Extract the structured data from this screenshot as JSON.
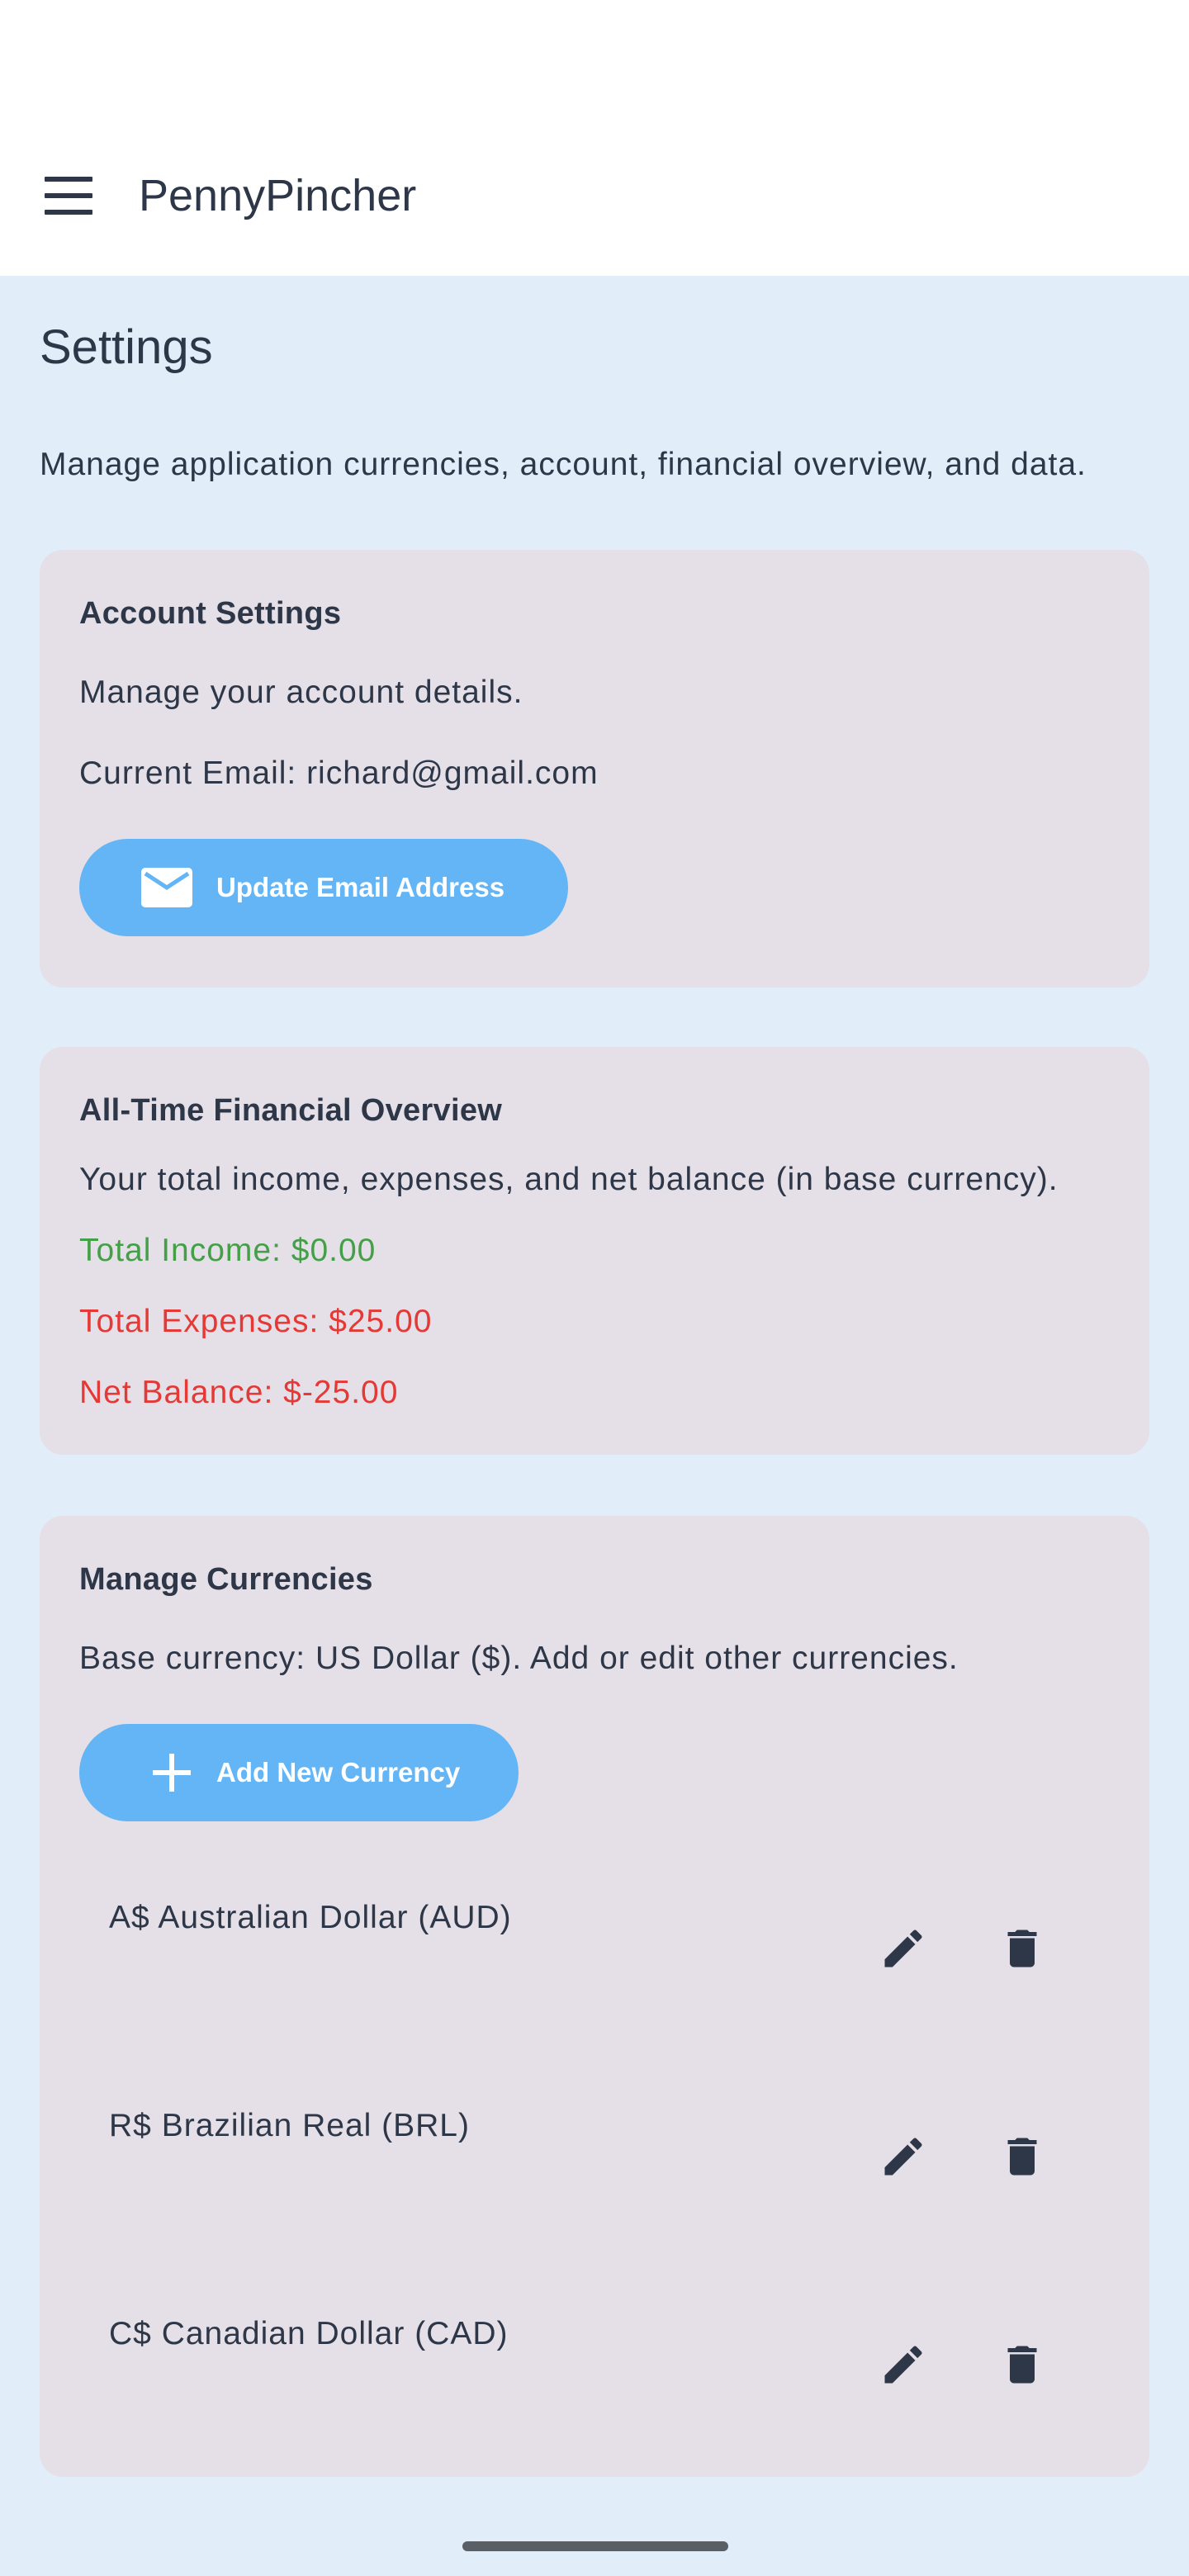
{
  "app": {
    "title": "PennyPincher",
    "menu_icon": "menu-icon"
  },
  "page": {
    "title": "Settings",
    "description": "Manage application currencies, account, financial overview, and data."
  },
  "account": {
    "title": "Account Settings",
    "subtitle": "Manage your account details.",
    "current_email": "Current Email: richard@gmail.com",
    "update_button": "Update Email Address",
    "update_icon": "mail-icon"
  },
  "overview": {
    "title": "All-Time Financial Overview",
    "subtitle": "Your total income, expenses, and net balance (in base currency).",
    "total_income": "Total Income: $0.00",
    "total_expenses": "Total Expenses: $25.00",
    "net_balance": "Net Balance: $-25.00",
    "colors": {
      "income": "#43a047",
      "expense": "#e53935"
    }
  },
  "currencies": {
    "title": "Manage Currencies",
    "subtitle": "Base currency: US Dollar ($). Add or edit other currencies.",
    "add_button": "Add New Currency",
    "add_icon": "plus-icon",
    "items": [
      {
        "label": "A$ Australian Dollar (AUD)"
      },
      {
        "label": "R$ Brazilian Real (BRL)"
      },
      {
        "label": "C$ Canadian Dollar (CAD)"
      }
    ]
  },
  "theme": {
    "background": "#e1eefa",
    "card": "#e5dfe7",
    "accent": "#64b5f6",
    "text": "#2d3748"
  }
}
